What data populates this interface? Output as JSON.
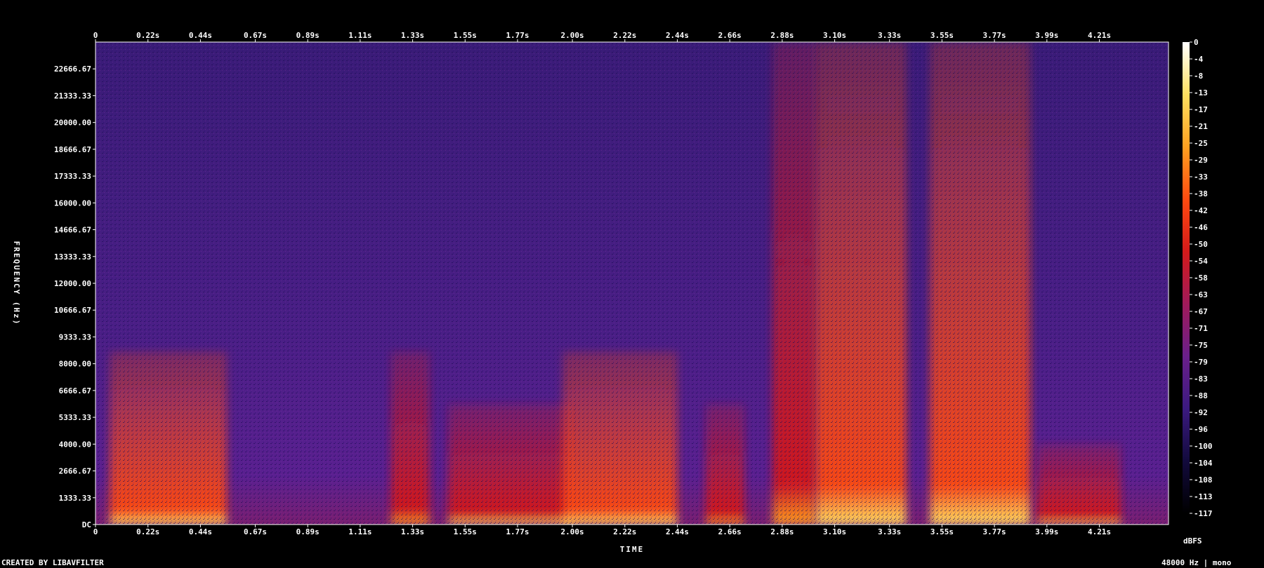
{
  "chart_data": {
    "type": "heatmap",
    "title": "",
    "xlabel": "TIME",
    "ylabel": "FREQUENCY (Hz)",
    "colorbar_label": "dBFS",
    "xlim": [
      0,
      4.5
    ],
    "ylim": [
      0,
      24000
    ],
    "colorbar_range": [
      -120,
      0
    ],
    "x_ticks": [
      {
        "value": 0,
        "label": "0"
      },
      {
        "value": 0.22,
        "label": "0.22s"
      },
      {
        "value": 0.44,
        "label": "0.44s"
      },
      {
        "value": 0.67,
        "label": "0.67s"
      },
      {
        "value": 0.89,
        "label": "0.89s"
      },
      {
        "value": 1.11,
        "label": "1.11s"
      },
      {
        "value": 1.33,
        "label": "1.33s"
      },
      {
        "value": 1.55,
        "label": "1.55s"
      },
      {
        "value": 1.77,
        "label": "1.77s"
      },
      {
        "value": 2.0,
        "label": "2.00s"
      },
      {
        "value": 2.22,
        "label": "2.22s"
      },
      {
        "value": 2.44,
        "label": "2.44s"
      },
      {
        "value": 2.66,
        "label": "2.66s"
      },
      {
        "value": 2.88,
        "label": "2.88s"
      },
      {
        "value": 3.1,
        "label": "3.10s"
      },
      {
        "value": 3.33,
        "label": "3.33s"
      },
      {
        "value": 3.55,
        "label": "3.55s"
      },
      {
        "value": 3.77,
        "label": "3.77s"
      },
      {
        "value": 3.99,
        "label": "3.99s"
      },
      {
        "value": 4.21,
        "label": "4.21s"
      }
    ],
    "y_ticks": [
      {
        "value": 0,
        "label": "DC"
      },
      {
        "value": 1333.33,
        "label": "1333.33"
      },
      {
        "value": 2666.67,
        "label": "2666.67"
      },
      {
        "value": 4000,
        "label": "4000.00"
      },
      {
        "value": 5333.33,
        "label": "5333.33"
      },
      {
        "value": 6666.67,
        "label": "6666.67"
      },
      {
        "value": 8000,
        "label": "8000.00"
      },
      {
        "value": 9333.33,
        "label": "9333.33"
      },
      {
        "value": 10666.67,
        "label": "10666.67"
      },
      {
        "value": 12000,
        "label": "12000.00"
      },
      {
        "value": 13333.33,
        "label": "13333.33"
      },
      {
        "value": 14666.67,
        "label": "14666.67"
      },
      {
        "value": 16000,
        "label": "16000.00"
      },
      {
        "value": 17333.33,
        "label": "17333.33"
      },
      {
        "value": 18666.67,
        "label": "18666.67"
      },
      {
        "value": 20000,
        "label": "20000.00"
      },
      {
        "value": 21333.33,
        "label": "21333.33"
      },
      {
        "value": 22666.67,
        "label": "22666.67"
      }
    ],
    "colorbar_ticks": [
      "0",
      "-4",
      "-8",
      "-13",
      "-17",
      "-21",
      "-25",
      "-29",
      "-33",
      "-38",
      "-42",
      "-46",
      "-50",
      "-54",
      "-58",
      "-63",
      "-67",
      "-71",
      "-75",
      "-79",
      "-83",
      "-88",
      "-92",
      "-96",
      "-100",
      "-104",
      "-108",
      "-113",
      "-117"
    ],
    "energy_regions": [
      {
        "t_start": 0.06,
        "t_end": 0.55,
        "f_max": 8600,
        "level_db": -45
      },
      {
        "t_start": 1.24,
        "t_end": 1.4,
        "f_max": 8600,
        "level_db": -52
      },
      {
        "t_start": 1.48,
        "t_end": 2.0,
        "f_max": 6000,
        "level_db": -48
      },
      {
        "t_start": 1.96,
        "t_end": 2.44,
        "f_max": 8600,
        "level_db": -45
      },
      {
        "t_start": 2.56,
        "t_end": 2.72,
        "f_max": 6000,
        "level_db": -52
      },
      {
        "t_start": 2.84,
        "t_end": 3.02,
        "f_max": 24000,
        "level_db": -52
      },
      {
        "t_start": 3.02,
        "t_end": 3.4,
        "f_max": 24000,
        "level_db": -40
      },
      {
        "t_start": 3.5,
        "t_end": 3.92,
        "f_max": 24000,
        "level_db": -42
      },
      {
        "t_start": 3.95,
        "t_end": 4.3,
        "f_max": 4000,
        "level_db": -48
      }
    ],
    "colormap": [
      "#000000",
      "#120a3d",
      "#3b1a80",
      "#6a1f8a",
      "#a01a5a",
      "#d41a1a",
      "#ff4a10",
      "#ffa020",
      "#ffe060",
      "#ffffff"
    ]
  },
  "footer": {
    "left_text": "CREATED BY LIBAVFILTER",
    "right_text": "48000 Hz | mono"
  }
}
